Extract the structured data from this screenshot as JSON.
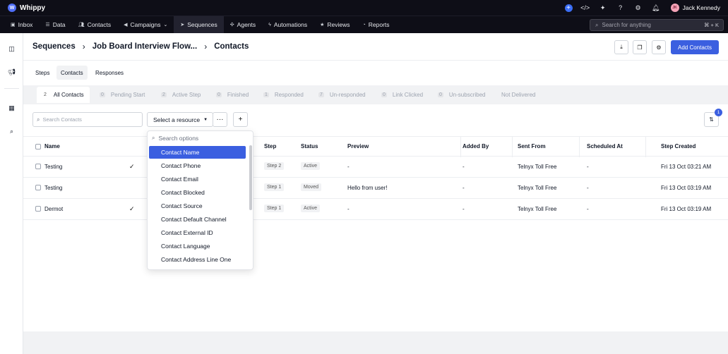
{
  "app": {
    "name": "Whippy",
    "logo_letter": "W"
  },
  "user": {
    "name": "Jack Kennedy",
    "initials": "JK"
  },
  "nav": {
    "items": [
      {
        "label": "Inbox",
        "icon": "inbox-icon"
      },
      {
        "label": "Data",
        "icon": "data-icon"
      },
      {
        "label": "Contacts",
        "icon": "contacts-icon"
      },
      {
        "label": "Campaigns",
        "icon": "megaphone-icon"
      },
      {
        "label": "Sequences",
        "icon": "sequences-icon"
      },
      {
        "label": "Agents",
        "icon": "agents-icon"
      },
      {
        "label": "Automations",
        "icon": "bolt-icon"
      },
      {
        "label": "Reviews",
        "icon": "star-icon"
      },
      {
        "label": "Reports",
        "icon": "reports-icon"
      }
    ],
    "active": "Sequences",
    "search_placeholder": "Search for anything",
    "search_shortcut": "⌘ + K"
  },
  "breadcrumb": [
    "Sequences",
    "Job Board Interview Flow...",
    "Contacts"
  ],
  "header": {
    "add_contacts_label": "Add Contacts"
  },
  "subtabs": [
    "Steps",
    "Contacts",
    "Responses"
  ],
  "subtab_active": "Contacts",
  "filters": [
    {
      "count": "2",
      "label": "All Contacts"
    },
    {
      "count": "0",
      "label": "Pending Start"
    },
    {
      "count": "2",
      "label": "Active Step"
    },
    {
      "count": "0",
      "label": "Finished"
    },
    {
      "count": "1",
      "label": "Responded"
    },
    {
      "count": "7",
      "label": "Un-responded"
    },
    {
      "count": "0",
      "label": "Link Clicked"
    },
    {
      "count": "0",
      "label": "Un-subscribed"
    },
    {
      "count": "",
      "label": "Not Delivered"
    }
  ],
  "toolbar": {
    "search_placeholder": "Search Contacts",
    "resource_select": "Select a resource",
    "more_label": "···",
    "add_label": "+",
    "sort_badge": "1"
  },
  "table": {
    "columns": [
      "Name",
      "Step",
      "Status",
      "Preview",
      "Added By",
      "Sent From",
      "Scheduled At",
      "Step Created"
    ],
    "rows": [
      {
        "name": "Testing",
        "checked": true,
        "step": "Step 2",
        "status": "Active",
        "preview": "-",
        "added_by": "-",
        "sent_from": "Telnyx Toll Free",
        "scheduled_at": "-",
        "step_created": "Fri 13 Oct 03:21 AM"
      },
      {
        "name": "Testing",
        "checked": false,
        "step": "Step 1",
        "status": "Moved",
        "preview": "Hello from user!",
        "added_by": "-",
        "sent_from": "Telnyx Toll Free",
        "scheduled_at": "-",
        "step_created": "Fri 13 Oct 03:19 AM"
      },
      {
        "name": "Dermot",
        "checked": true,
        "step": "Step 1",
        "status": "Active",
        "preview": "-",
        "added_by": "-",
        "sent_from": "Telnyx Toll Free",
        "scheduled_at": "-",
        "step_created": "Fri 13 Oct 03:19 AM"
      }
    ]
  },
  "dropdown": {
    "search_placeholder": "Search options",
    "options": [
      "Contact Name",
      "Contact Phone",
      "Contact Email",
      "Contact Blocked",
      "Contact Source",
      "Contact Default Channel",
      "Contact External ID",
      "Contact Language",
      "Contact Address Line One"
    ],
    "selected": "Contact Name"
  },
  "colors": {
    "topbar": "#0e0e17",
    "accent": "#3b5fe0"
  }
}
